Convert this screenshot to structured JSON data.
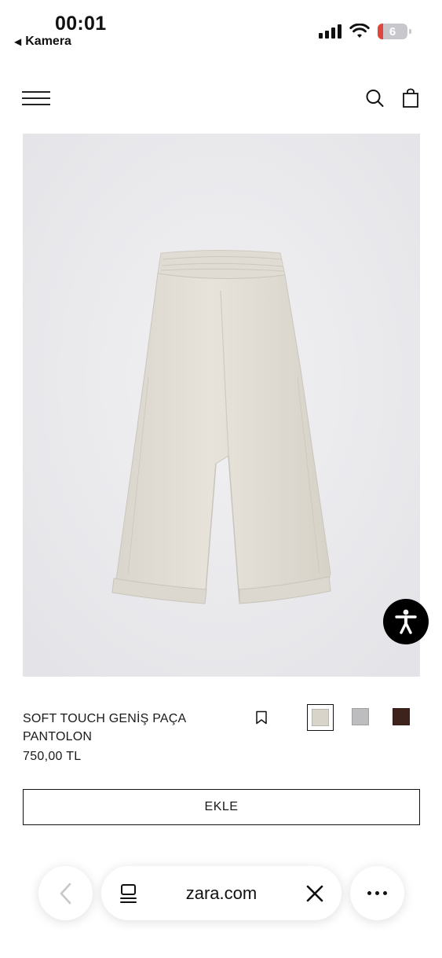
{
  "status_bar": {
    "time": "00:01",
    "back_app": "Kamera",
    "battery_level": "6",
    "icons": [
      "signal-icon",
      "wifi-icon",
      "battery-icon"
    ]
  },
  "nav": {
    "icons": [
      "menu-icon",
      "search-icon",
      "shopping-bag-icon"
    ]
  },
  "product": {
    "image_icon": "trousers-image",
    "name": "SOFT TOUCH GENİŞ PAÇA PANTOLON",
    "price": "750,00 TL",
    "colors": [
      "#d8d4ca",
      "#bdbdc0",
      "#3d231b"
    ],
    "selected_color_index": 0,
    "add_label": "EKLE"
  },
  "accessibility": {
    "icon": "accessibility-icon"
  },
  "browser": {
    "url": "zara.com",
    "icons": [
      "back-arrow-icon",
      "tabs-icon",
      "close-icon",
      "more-icon"
    ]
  }
}
